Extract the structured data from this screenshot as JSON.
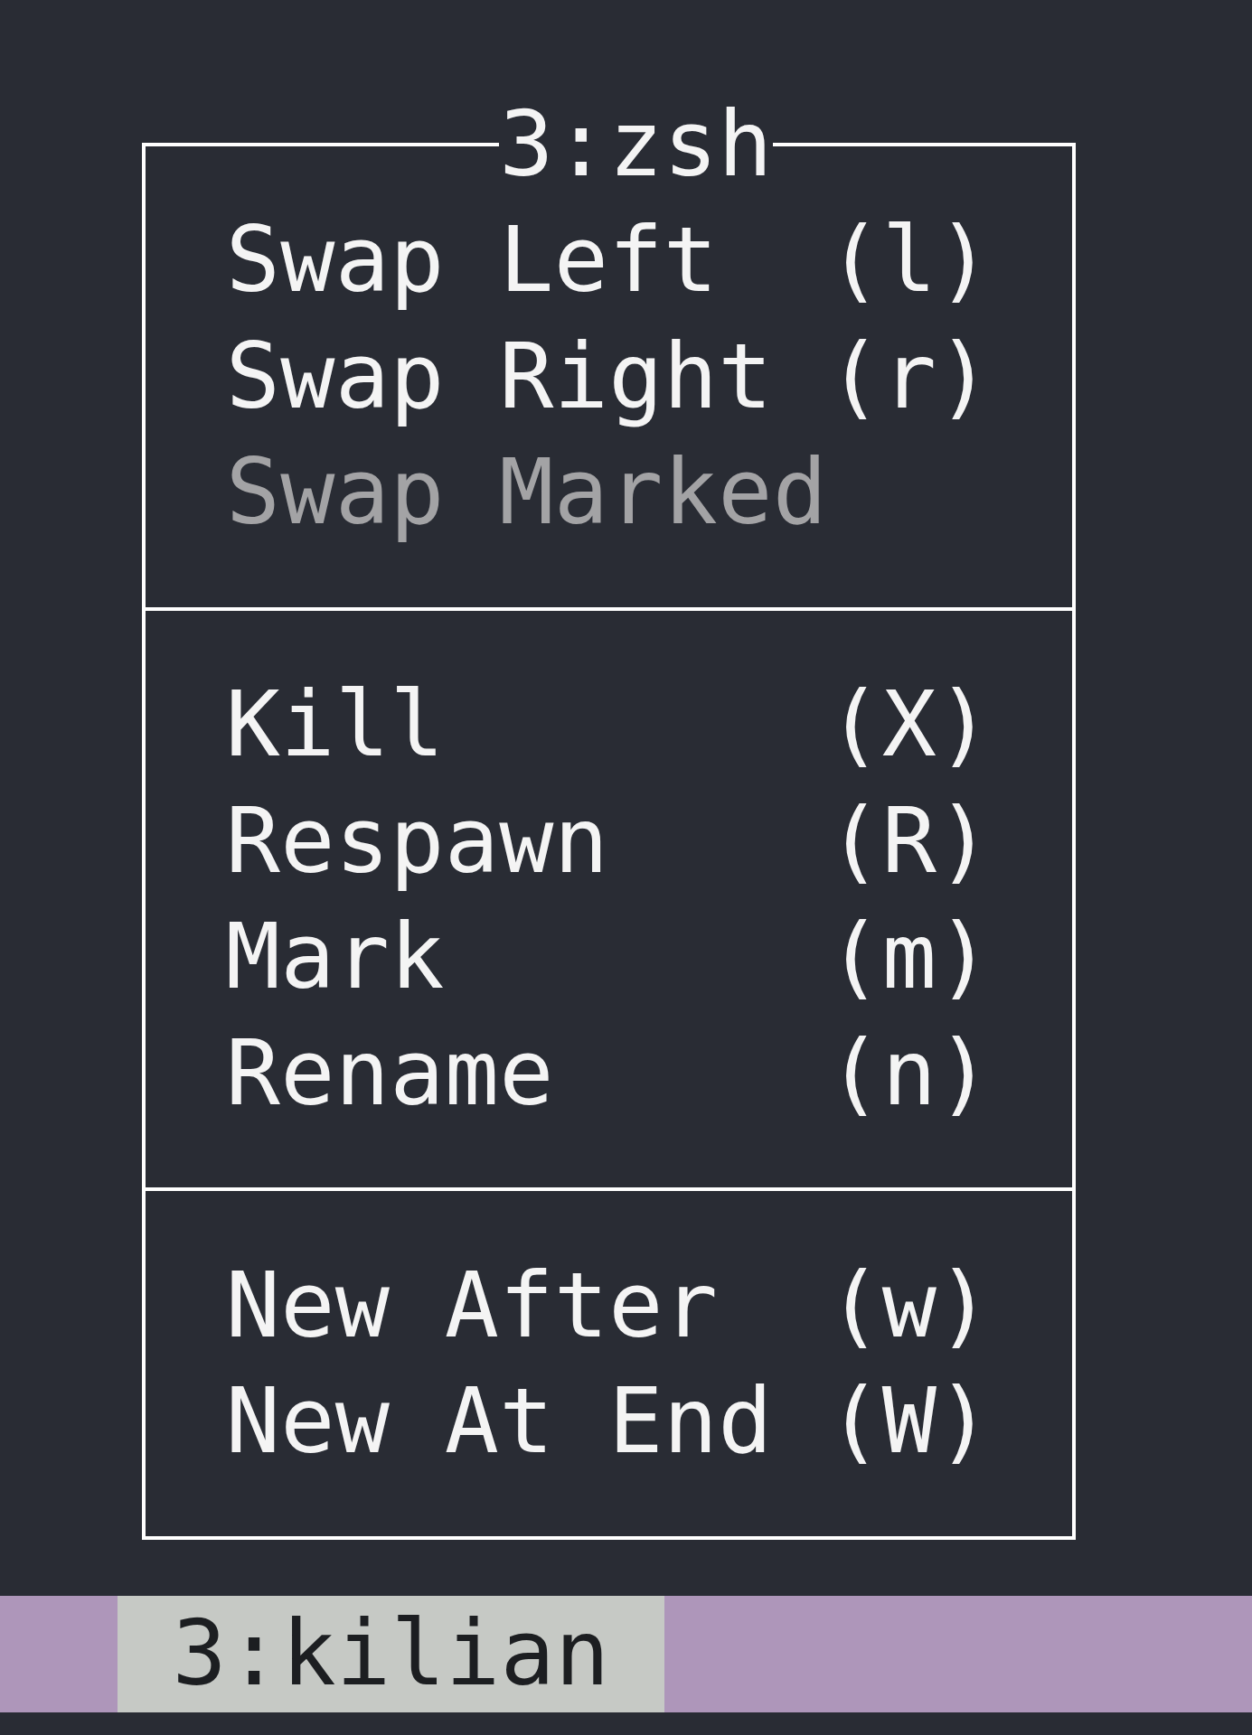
{
  "menu": {
    "title": "3:zsh",
    "groups": [
      {
        "items": [
          {
            "label": "Swap Left",
            "shortcut": "(l)",
            "disabled": false
          },
          {
            "label": "Swap Right",
            "shortcut": "(r)",
            "disabled": false
          },
          {
            "label": "Swap Marked",
            "disabled": true
          }
        ]
      },
      {
        "items": [
          {
            "label": "Kill",
            "shortcut": "(X)",
            "disabled": false
          },
          {
            "label": "Respawn",
            "shortcut": "(R)",
            "disabled": false
          },
          {
            "label": "Mark",
            "shortcut": "(m)",
            "disabled": false
          },
          {
            "label": "Rename",
            "shortcut": "(n)",
            "disabled": false
          }
        ]
      },
      {
        "items": [
          {
            "label": "New After",
            "shortcut": "(w)",
            "disabled": false
          },
          {
            "label": "New At End",
            "shortcut": "(W)",
            "disabled": false
          }
        ]
      }
    ]
  },
  "status_bar": {
    "windows": [
      {
        "label": "3:kilian",
        "selected": true
      }
    ]
  }
}
